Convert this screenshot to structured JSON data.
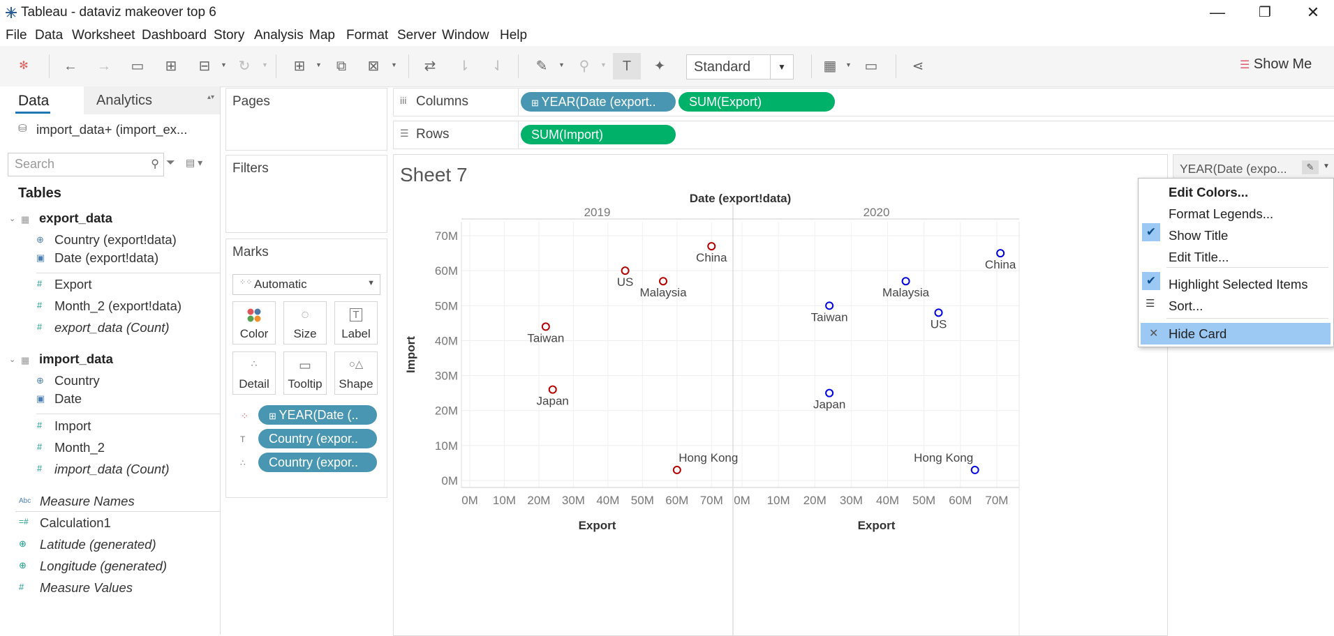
{
  "window": {
    "title": "Tableau - dataviz makeover top 6",
    "minimize": "—",
    "restore": "❐",
    "close": "✕"
  },
  "menu": [
    "File",
    "Data",
    "Worksheet",
    "Dashboard",
    "Story",
    "Analysis",
    "Map",
    "Format",
    "Server",
    "Window",
    "Help"
  ],
  "toolbar": {
    "fit_value": "Standard",
    "show_me": "Show Me"
  },
  "data_pane": {
    "tab_data": "Data",
    "tab_analytics": "Analytics",
    "datasource": "import_data+ (import_ex...",
    "search_placeholder": "Search",
    "tables_header": "Tables",
    "export_table": "export_data",
    "export_fields": [
      "Country (export!data)",
      "Date (export!data)",
      "Export",
      "Month_2 (export!data)",
      "export_data (Count)"
    ],
    "import_table": "import_data",
    "import_fields": [
      "Country",
      "Date",
      "Import",
      "Month_2",
      "import_data (Count)"
    ],
    "other_fields": [
      "Measure Names",
      "Calculation1",
      "Latitude (generated)",
      "Longitude (generated)",
      "Measure Values"
    ]
  },
  "shelves": {
    "pages": "Pages",
    "filters": "Filters",
    "marks": "Marks",
    "mark_type": "Automatic",
    "mark_buttons": [
      "Color",
      "Size",
      "Label",
      "Detail",
      "Tooltip",
      "Shape"
    ],
    "mark_pills": [
      "YEAR(Date (..",
      "Country (expor..",
      "Country (expor.."
    ],
    "columns_label": "Columns",
    "rows_label": "Rows",
    "columns_pills": [
      "YEAR(Date (export..",
      "SUM(Export)"
    ],
    "rows_pills": [
      "SUM(Import)"
    ]
  },
  "legend": {
    "title": "YEAR(Date (expo..."
  },
  "context_menu": {
    "items": [
      "Edit Colors...",
      "Format Legends...",
      "Show Title",
      "Edit Title...",
      "Highlight Selected Items",
      "Sort...",
      "Hide Card"
    ]
  },
  "colors": {
    "pill_blue": "#4996b2",
    "pill_green": "#00b16a",
    "mark_2019": "#b40000",
    "mark_2020": "#0000e0",
    "menu_highlight": "#9cc9f3"
  },
  "chart_data": {
    "type": "scatter",
    "title": "Sheet 7",
    "column_header": "Date (export!data)",
    "xlabel": "Export",
    "ylabel": "Import",
    "xlim": [
      0,
      75
    ],
    "ylim": [
      -2,
      74
    ],
    "x_ticks": [
      "0M",
      "10M",
      "20M",
      "30M",
      "40M",
      "50M",
      "60M",
      "70M"
    ],
    "y_ticks": [
      "0M",
      "10M",
      "20M",
      "30M",
      "40M",
      "50M",
      "60M",
      "70M"
    ],
    "panels": [
      {
        "year": "2019",
        "points": [
          {
            "label": "China",
            "x": 70,
            "y": 67
          },
          {
            "label": "US",
            "x": 45,
            "y": 60
          },
          {
            "label": "Malaysia",
            "x": 56,
            "y": 57
          },
          {
            "label": "Taiwan",
            "x": 22,
            "y": 44
          },
          {
            "label": "Japan",
            "x": 24,
            "y": 26
          },
          {
            "label": "Hong Kong",
            "x": 60,
            "y": 3
          }
        ]
      },
      {
        "year": "2020",
        "points": [
          {
            "label": "China",
            "x": 71,
            "y": 65
          },
          {
            "label": "Malaysia",
            "x": 45,
            "y": 57
          },
          {
            "label": "Taiwan",
            "x": 24,
            "y": 50
          },
          {
            "label": "US",
            "x": 54,
            "y": 48
          },
          {
            "label": "Japan",
            "x": 24,
            "y": 25
          },
          {
            "label": "Hong Kong",
            "x": 64,
            "y": 3
          }
        ]
      }
    ]
  }
}
